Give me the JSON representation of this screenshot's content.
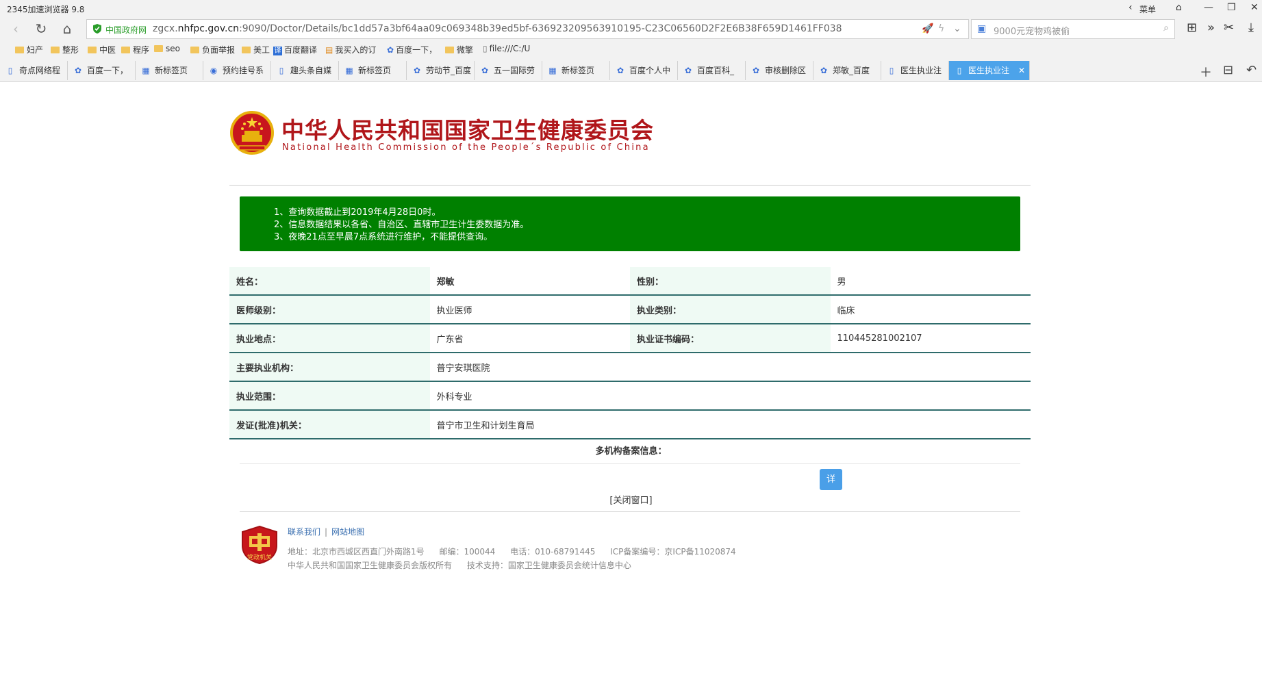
{
  "browser": {
    "app_title": "2345加速浏览器 9.8",
    "menu_label": "菜单",
    "gov_label": "中国政府网",
    "url_prefix": "zgcx.",
    "url_host": "nhfpc.gov.cn",
    "url_rest": ":9090/Doctor/Details/bc1dd57a3bf64aa09c069348b39ed5bf-636923209563910195-C23C06560D2F2E6B38F659D1461FF038",
    "search_text": "9000元宠物鸡被偷"
  },
  "bookmarks": [
    {
      "label": "妇产",
      "icon": "folder"
    },
    {
      "label": "整形",
      "icon": "folder"
    },
    {
      "label": "中医",
      "icon": "folder"
    },
    {
      "label": "程序",
      "icon": "folder"
    },
    {
      "label": "seo",
      "icon": "folder"
    },
    {
      "label": "负面举报",
      "icon": "folder"
    },
    {
      "label": "美工",
      "icon": "folder"
    },
    {
      "label": "百度翻译",
      "icon": "translate"
    },
    {
      "label": "我买入的订",
      "icon": "cart"
    },
    {
      "label": "百度一下，",
      "icon": "paw"
    },
    {
      "label": "微擎",
      "icon": "folder"
    },
    {
      "label": "file:///C:/U",
      "icon": "file"
    }
  ],
  "tabs": [
    {
      "label": "奇点网络程",
      "icon": "page"
    },
    {
      "label": "百度一下，",
      "icon": "paw"
    },
    {
      "label": "新标签页",
      "icon": "grid"
    },
    {
      "label": "预约挂号系",
      "icon": "globe"
    },
    {
      "label": "趣头条自媒",
      "icon": "page"
    },
    {
      "label": "新标签页",
      "icon": "grid"
    },
    {
      "label": "劳动节_百度",
      "icon": "paw"
    },
    {
      "label": "五一国际劳",
      "icon": "paw"
    },
    {
      "label": "新标签页",
      "icon": "grid"
    },
    {
      "label": "百度个人中",
      "icon": "paw"
    },
    {
      "label": "百度百科_",
      "icon": "paw"
    },
    {
      "label": "审核删除区",
      "icon": "paw"
    },
    {
      "label": "郑敏_百度",
      "icon": "paw"
    },
    {
      "label": "医生执业注",
      "icon": "page"
    },
    {
      "label": "医生执业注",
      "icon": "page",
      "active": true
    }
  ],
  "header": {
    "title_cn": "中华人民共和国国家卫生健康委员会",
    "title_en": "National Health Commission of the People´s Republic of China"
  },
  "notice": [
    "1、查询数据截止到2019年4月28日0时。",
    "2、信息数据结果以各省、自治区、直辖市卫生计生委数据为准。",
    "3、夜晚21点至早晨7点系统进行维护，不能提供查询。"
  ],
  "info": {
    "name_label": "姓名：",
    "name": "郑敏",
    "gender_label": "性别：",
    "gender": "男",
    "level_label": "医师级别：",
    "level": "执业医师",
    "category_label": "执业类别：",
    "category": "临床",
    "location_label": "执业地点：",
    "location": "广东省",
    "cert_label": "执业证书编码：",
    "cert": "110445281002107",
    "org_label": "主要执业机构：",
    "org": "普宁安琪医院",
    "scope_label": "执业范围：",
    "scope": "外科专业",
    "issuer_label": "发证(批准)机关：",
    "issuer": "普宁市卫生和计划生育局"
  },
  "multi": {
    "title": "多机构备案信息：",
    "detail_btn": "详",
    "close": "[关闭窗口]"
  },
  "footer": {
    "contact": "联系我们",
    "sep": "|",
    "sitemap": "网站地图",
    "address": "地址：北京市西城区西直门外南路1号",
    "postcode": "邮编：100044",
    "phone": "电话：010-68791445",
    "icp": "ICP备案编号：京ICP备11020874",
    "copyright": "中华人民共和国国家卫生健康委员会版权所有",
    "support": "技术支持：国家卫生健康委员会统计信息中心",
    "badge_text": "党政机关"
  },
  "colors": {
    "notice_bg": "#008000",
    "title_red": "#b0161a",
    "active_tab": "#4ca3ea",
    "row_border": "#2e6b6b",
    "label_bg": "#effaf4"
  }
}
